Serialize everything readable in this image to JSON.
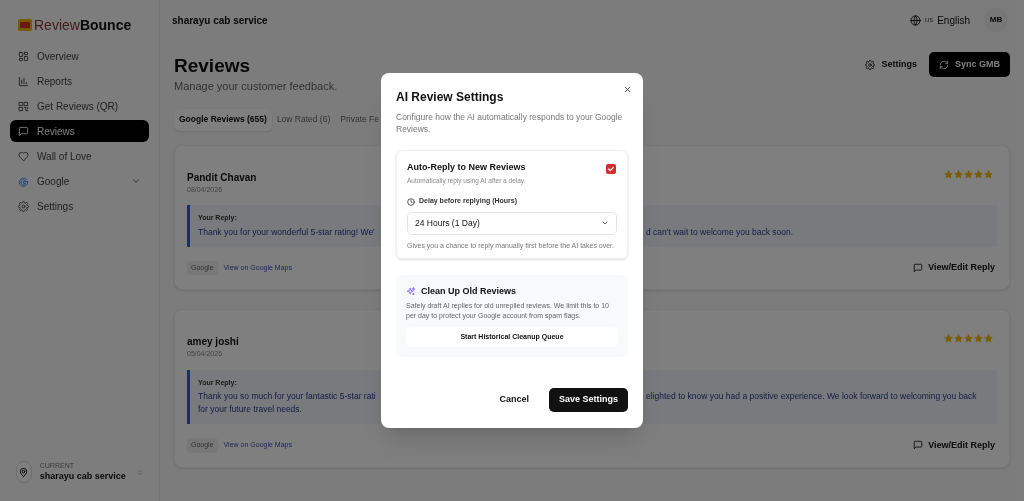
{
  "brand": {
    "name_light": "Review",
    "name_bold": "Bounce"
  },
  "header": {
    "business": "sharayu cab service",
    "language_code": "us",
    "language": "English",
    "avatar": "MB"
  },
  "sidebar": {
    "items": [
      {
        "label": "Overview",
        "selected": false
      },
      {
        "label": "Reports",
        "selected": false
      },
      {
        "label": "Get Reviews (QR)",
        "selected": false
      },
      {
        "label": "Reviews",
        "selected": true
      },
      {
        "label": "Wall of Love",
        "selected": false
      },
      {
        "label": "Google",
        "selected": false,
        "expandable": true
      },
      {
        "label": "Settings",
        "selected": false
      }
    ],
    "current_label": "CURRENT",
    "current_business": "sharayu cab service"
  },
  "page": {
    "title": "Reviews",
    "subtitle": "Manage your customer feedback.",
    "settings_button": "Settings",
    "sync_button": "Sync GMB"
  },
  "tabs": [
    {
      "label": "Google Reviews (655)",
      "selected": true
    },
    {
      "label": "Low Rated (6)",
      "selected": false
    },
    {
      "label": "Private Fe",
      "selected": false
    }
  ],
  "reviews": [
    {
      "author": "Pandit Chavan",
      "date": "08/04/2026",
      "stars": 5,
      "reply_label": "Your Reply:",
      "reply_lines": [
        {
          "left": "Thank you for your wonderful 5-star rating! We'",
          "right": "d can't wait to welcome you back soon."
        }
      ],
      "source": "Google",
      "maps_link": "View on Google Maps",
      "edit_button": "View/Edit Reply"
    },
    {
      "author": "amey joshi",
      "date": "05/04/2026",
      "stars": 5,
      "reply_label": "Your Reply:",
      "reply_lines": [
        {
          "left": "Thank you so much for your fantastic 5-star rati",
          "right": "elighted to know you had a positive experience. We look forward to welcoming you back"
        },
        {
          "left": "for your future travel needs."
        }
      ],
      "source": "Google",
      "maps_link": "View on Google Maps",
      "edit_button": "View/Edit Reply"
    }
  ],
  "modal": {
    "title": "AI Review Settings",
    "description": "Configure how the AI automatically responds to your Google Reviews.",
    "auto_reply": {
      "title": "Auto-Reply to New Reviews",
      "description": "Automatically reply using AI after a delay.",
      "checked": true,
      "delay_label": "Delay before replying (Hours)",
      "delay_value": "24 Hours (1 Day)",
      "hint": "Gives you a chance to reply manually first before the AI takes over."
    },
    "cleanup": {
      "title": "Clean Up Old Reviews",
      "description": "Safely draft AI replies for old unreplied reviews. We limit this to 10 per day to protect your Google account from spam flags.",
      "button": "Start Historical Cleanup Queue"
    },
    "cancel": "Cancel",
    "save": "Save Settings"
  }
}
